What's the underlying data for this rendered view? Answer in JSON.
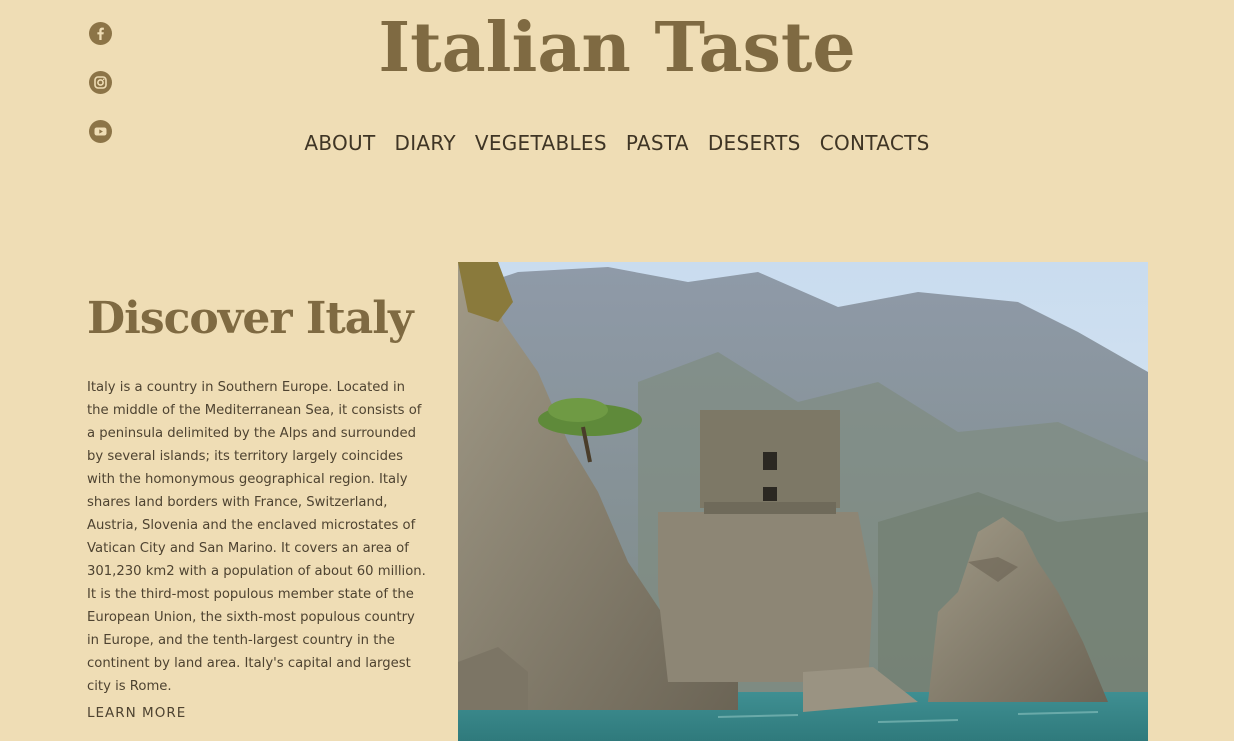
{
  "site": {
    "title": "Italian Taste"
  },
  "social": [
    {
      "name": "facebook-icon"
    },
    {
      "name": "instagram-icon"
    },
    {
      "name": "youtube-icon"
    }
  ],
  "nav": {
    "items": [
      {
        "label": "ABOUT"
      },
      {
        "label": "DIARY"
      },
      {
        "label": "VEGETABLES"
      },
      {
        "label": "PASTA"
      },
      {
        "label": "DESERTS"
      },
      {
        "label": "CONTACTS"
      }
    ]
  },
  "hero": {
    "heading": "Discover Italy",
    "body": "Italy is a country in Southern Europe. Located in the middle of the Mediterranean Sea, it consists of a peninsula delimited by the Alps and surrounded by several islands; its territory largely coincides with the homonymous geographical region. Italy shares land borders with France, Switzerland, Austria, Slovenia and the enclaved microstates of Vatican City and San Marino. It covers an area of 301,230 km2 with a population of about 60 million. It is the third-most populous member state of the European Union, the sixth-most populous country in Europe, and the tenth-largest country in the continent by land area. Italy's capital and largest city is Rome.",
    "link": "LEARN MORE"
  },
  "colors": {
    "background": "#efddb5",
    "accent": "#7f6a42",
    "text": "#4e4331"
  }
}
